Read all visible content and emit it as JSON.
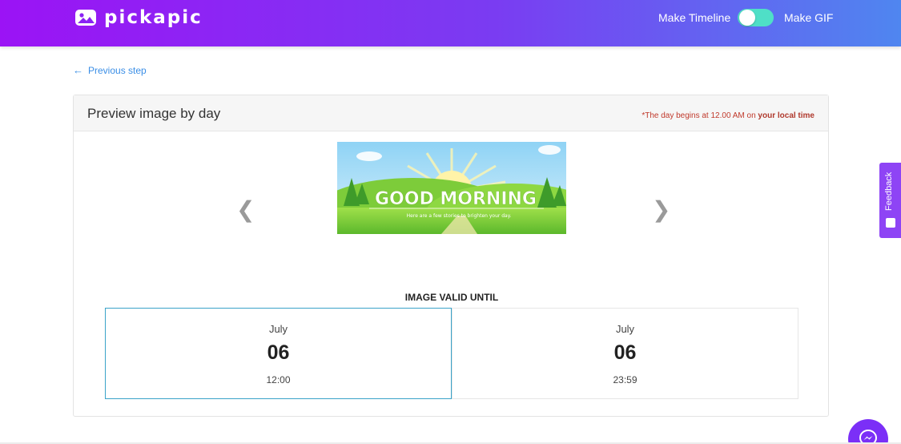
{
  "header": {
    "logo_text": "pickapic",
    "mode_left_label": "Make Timeline",
    "mode_right_label": "Make GIF"
  },
  "nav": {
    "previous_step_label": "Previous step"
  },
  "card": {
    "title": "Preview image by day",
    "note_prefix": "*The day begins at 12.00 AM on ",
    "note_emphasis": "your local time",
    "preview": {
      "headline": "GOOD MORNING",
      "subline": "Here are a few stories to brighten your day."
    },
    "valid_label": "IMAGE VALID UNTIL",
    "days": [
      {
        "month": "July",
        "day": "06",
        "time": "12:00"
      },
      {
        "month": "July",
        "day": "06",
        "time": "23:59"
      }
    ]
  },
  "feedback": {
    "label": "Feedback"
  },
  "icons": {
    "logo": "photo-logo-icon",
    "prev": "arrow-left-icon",
    "carousel_prev": "chevron-left-icon",
    "carousel_next": "chevron-right-icon",
    "messenger": "messenger-icon"
  },
  "colors": {
    "header_start": "#9b13f5",
    "header_end": "#4f86f0",
    "accent_link": "#3a8ee6",
    "toggle": "#4fdfc7",
    "feedback_tab": "#8e44f5",
    "note_red": "#c0392b"
  }
}
